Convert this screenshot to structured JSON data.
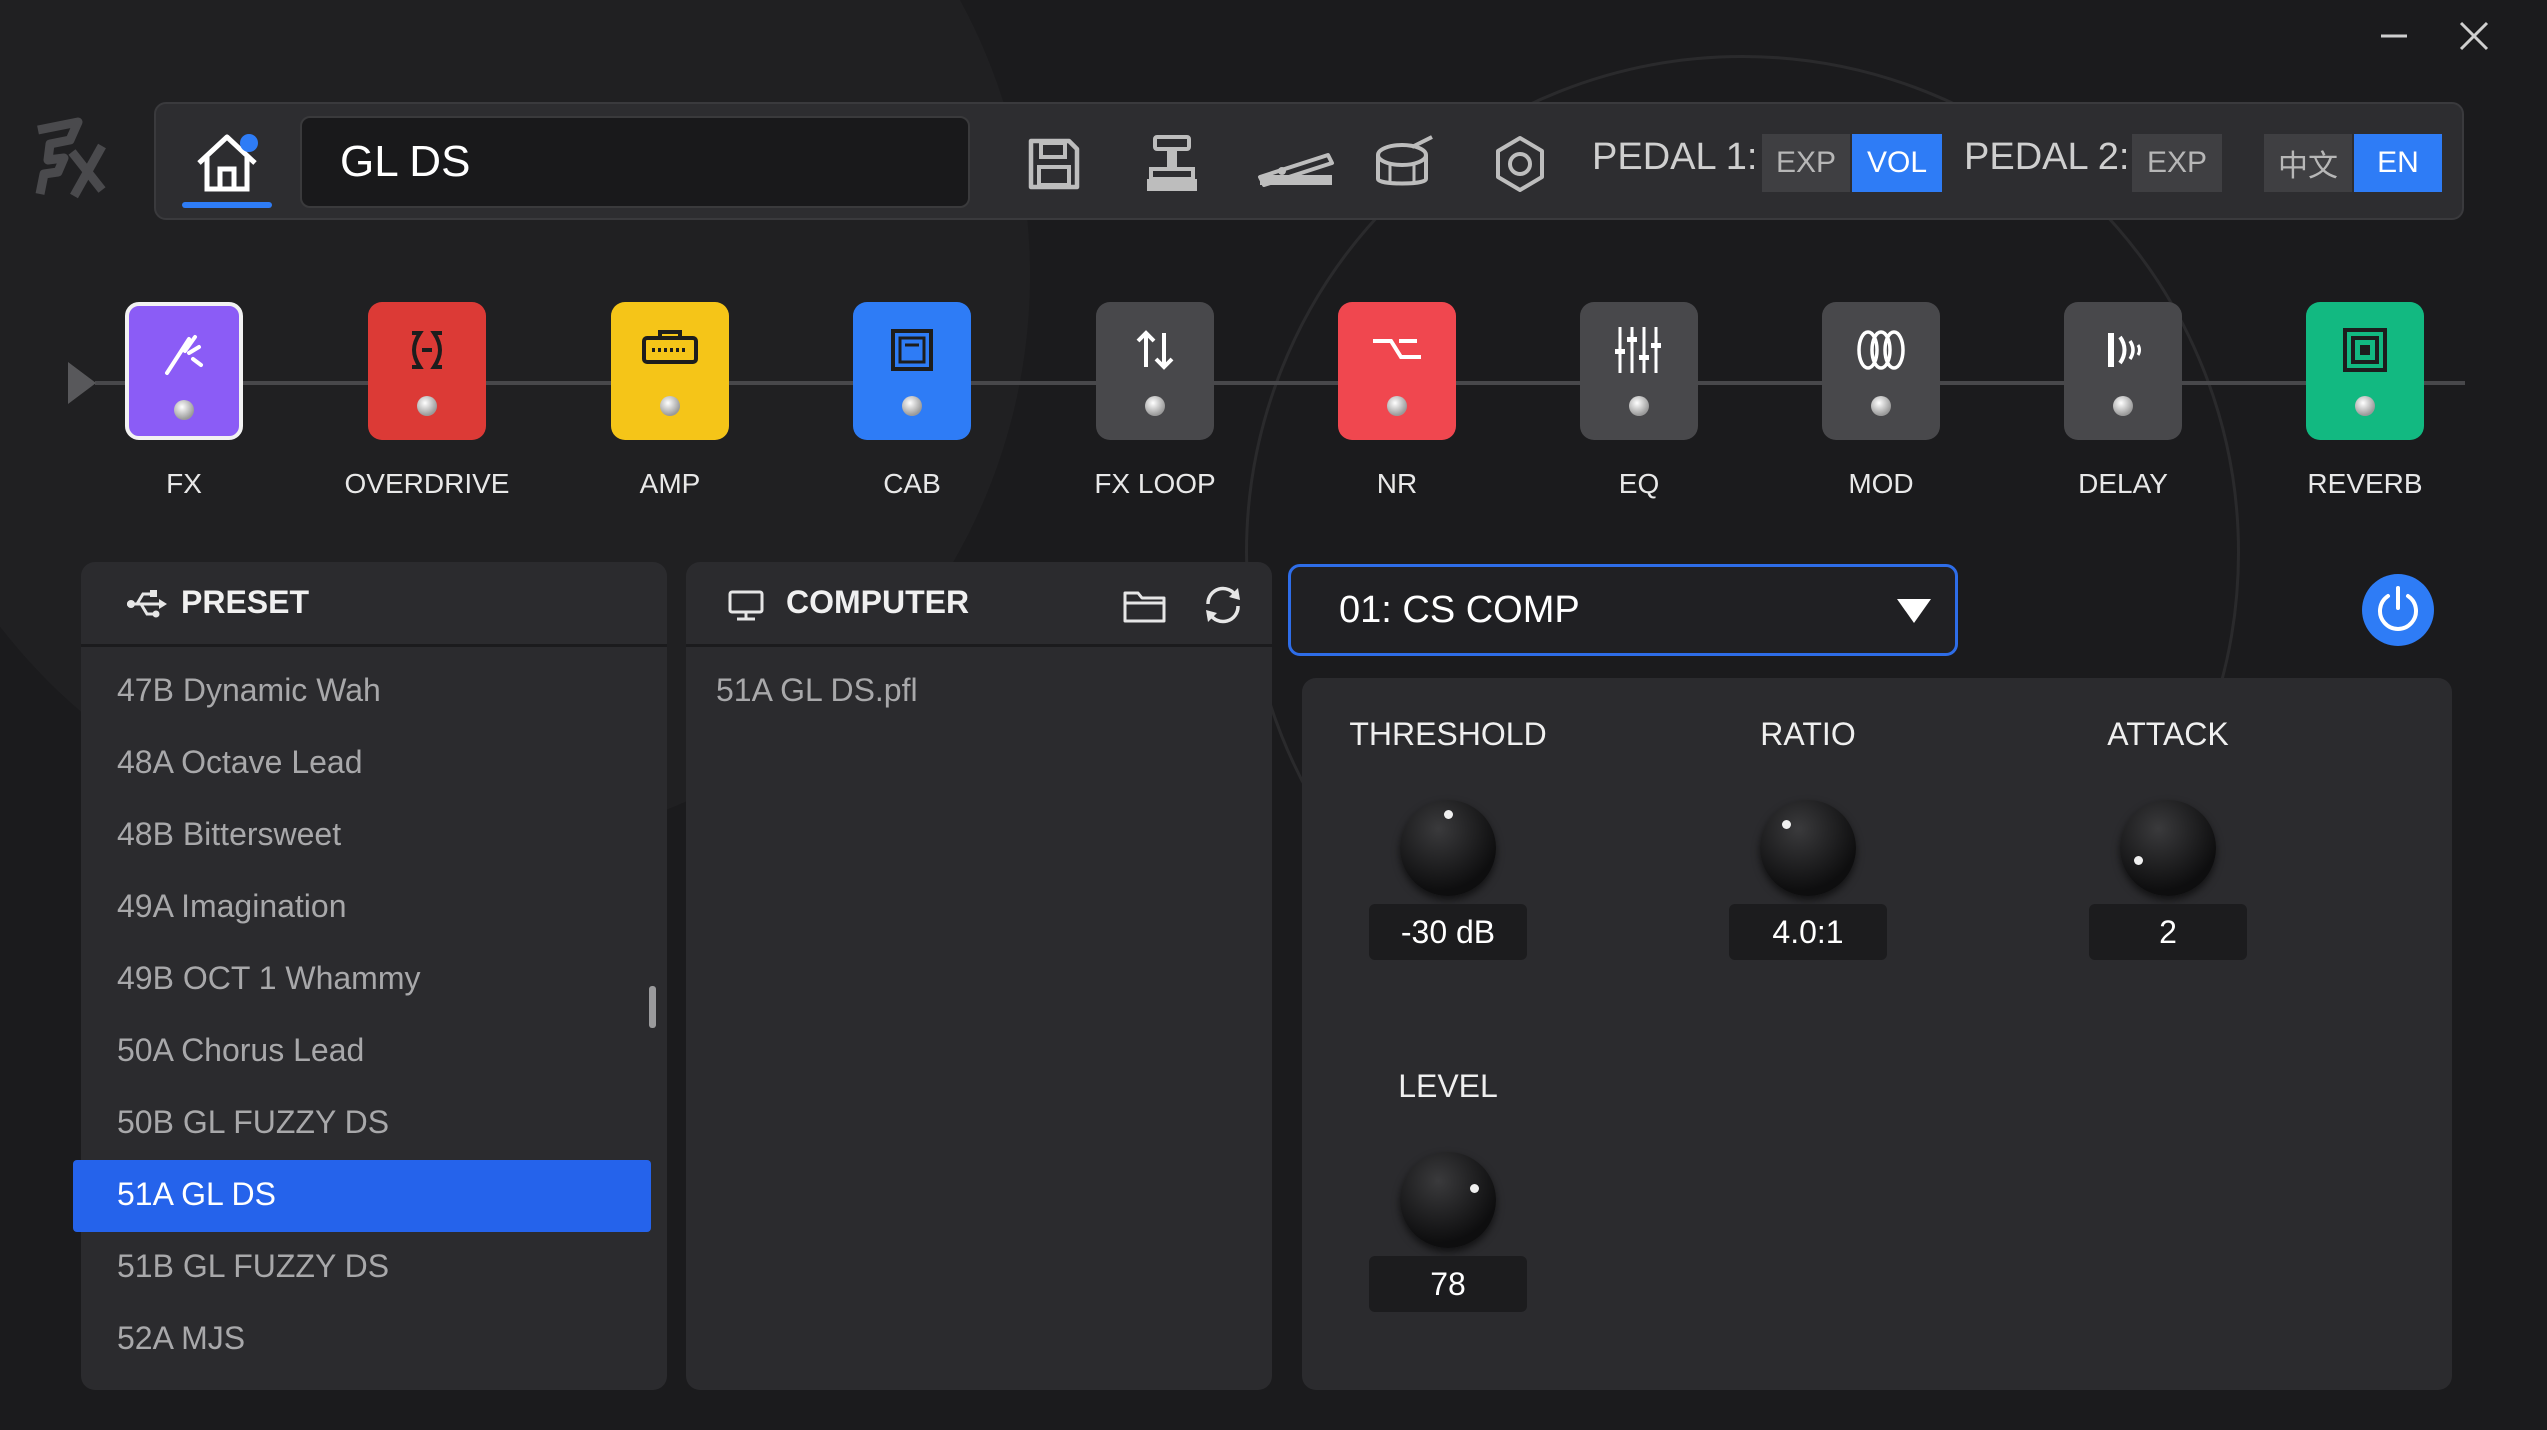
{
  "window": {
    "minimize_symbol": "—",
    "close_symbol": "✕"
  },
  "toolbar": {
    "preset_name": "GL DS",
    "pedal1_label": "PEDAL 1:",
    "pedal1_exp": "EXP",
    "pedal1_vol": "VOL",
    "pedal2_label": "PEDAL 2:",
    "pedal2_exp": "EXP",
    "lang_zh": "中文",
    "lang_en": "EN",
    "icons": [
      "home-icon",
      "save-icon",
      "pedal-icon",
      "expression-pedal-icon",
      "drum-icon",
      "settings-icon"
    ]
  },
  "chain": {
    "blocks": [
      {
        "label": "FX",
        "color": "#8b5cf6",
        "selected": true
      },
      {
        "label": "OVERDRIVE",
        "color": "#dc3a36"
      },
      {
        "label": "AMP",
        "color": "#f5c518"
      },
      {
        "label": "CAB",
        "color": "#2e7cf6"
      },
      {
        "label": "FX LOOP",
        "color": "#48484b"
      },
      {
        "label": "NR",
        "color": "#f0474f"
      },
      {
        "label": "EQ",
        "color": "#48484b"
      },
      {
        "label": "MOD",
        "color": "#48484b"
      },
      {
        "label": "DELAY",
        "color": "#48484b"
      },
      {
        "label": "REVERB",
        "color": "#12b981"
      }
    ]
  },
  "preset_panel": {
    "title": "PRESET",
    "items": [
      "47B Dynamic Wah",
      "48A Octave Lead",
      "48B Bittersweet",
      "49A Imagination",
      "49B OCT 1 Whammy",
      "50A Chorus Lead",
      "50B GL FUZZY DS",
      "51A GL DS",
      "51B GL FUZZY DS",
      "52A MJS"
    ],
    "selected": "51A GL DS"
  },
  "computer_panel": {
    "title": "COMPUTER",
    "files": [
      "51A GL DS.pfl"
    ]
  },
  "effect": {
    "selected": "01: CS COMP",
    "params": [
      {
        "label": "THRESHOLD",
        "value": "-30 dB"
      },
      {
        "label": "RATIO",
        "value": "4.0:1"
      },
      {
        "label": "ATTACK",
        "value": "2"
      },
      {
        "label": "LEVEL",
        "value": "78"
      }
    ]
  }
}
